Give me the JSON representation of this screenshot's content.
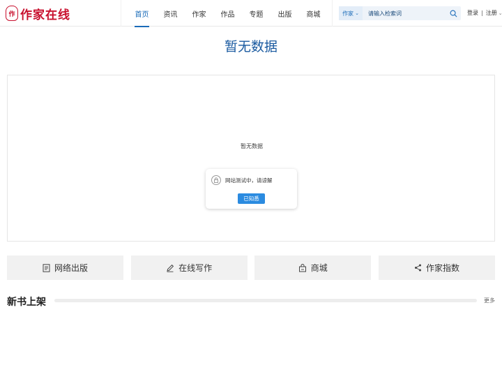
{
  "brand": {
    "logo_text": "作家在线",
    "seal_char": "作"
  },
  "nav": {
    "items": [
      {
        "label": "首页",
        "active": true
      },
      {
        "label": "资讯",
        "active": false
      },
      {
        "label": "作家",
        "active": false
      },
      {
        "label": "作品",
        "active": false
      },
      {
        "label": "专题",
        "active": false
      },
      {
        "label": "出版",
        "active": false
      },
      {
        "label": "商城",
        "active": false
      }
    ]
  },
  "search": {
    "type_label": "作家",
    "placeholder": "请输入检索词"
  },
  "auth": {
    "login": "登录",
    "separator": "|",
    "register": "注册"
  },
  "main": {
    "title": "暂无数据",
    "empty_text": "暂无数据",
    "dialog": {
      "message": "网站测试中，请谅解",
      "button": "已知悉"
    }
  },
  "features": [
    {
      "label": "网络出版",
      "icon": "document-icon"
    },
    {
      "label": "在线写作",
      "icon": "pen-icon"
    },
    {
      "label": "商城",
      "icon": "shop-icon"
    },
    {
      "label": "作家指数",
      "icon": "share-icon"
    }
  ],
  "new_books": {
    "title": "新书上架",
    "more": "更多"
  },
  "colors": {
    "accent": "#1a6bb8",
    "brand_red": "#c8102e",
    "button_blue": "#2b8be0"
  }
}
